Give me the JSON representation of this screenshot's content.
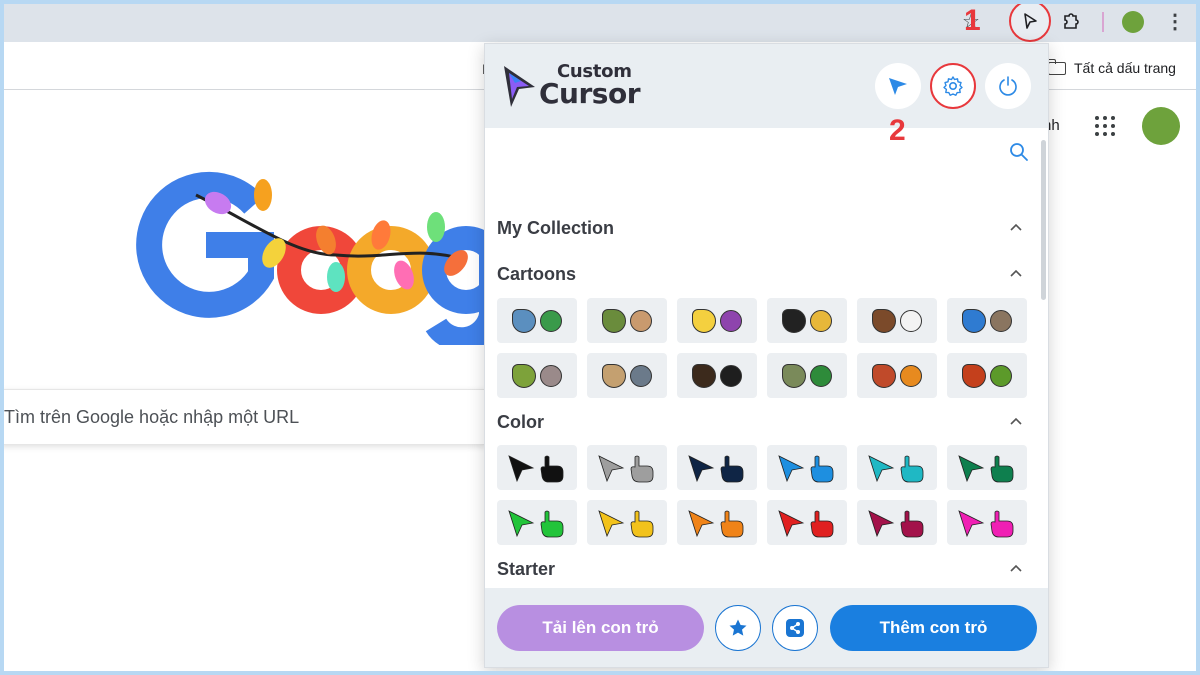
{
  "browser": {
    "bookmark_all_label": "Tất cả dấu trang",
    "bookmark_partial": "I",
    "step_labels": [
      "1",
      "2"
    ]
  },
  "google": {
    "header_partial_text": "nh",
    "search_placeholder": "Tìm trên Google hoặc nhập một URL",
    "logo_partial": "Goog"
  },
  "extension": {
    "logo": {
      "line1": "Custom",
      "line2": "Cursor"
    },
    "header_buttons": [
      "cursor-icon",
      "gear-icon",
      "power-icon"
    ],
    "sections": [
      {
        "title": "My Collection"
      },
      {
        "title": "Cartoons"
      },
      {
        "title": "Color"
      },
      {
        "title": "Starter"
      }
    ],
    "color_pairs": [
      "#111111",
      "#9e9e9e",
      "#0f2545",
      "#1e8fe0",
      "#1fb8c4",
      "#0e7f4e",
      "#22c43a",
      "#f2c21b",
      "#f08318",
      "#e02020",
      "#a3124a",
      "#f01fb4"
    ],
    "cartoon_colors": [
      [
        "#5b8fbf",
        "#3a9a4a"
      ],
      [
        "#6a8c3c",
        "#c99a6e"
      ],
      [
        "#f4d03f",
        "#8e44ad"
      ],
      [
        "#222222",
        "#e7b73a"
      ],
      [
        "#7b4a2a",
        "#f3f3f3"
      ],
      [
        "#2f7bd1",
        "#8a7560"
      ],
      [
        "#7da23a",
        "#9a8a8a"
      ],
      [
        "#c4a070",
        "#6b7a8a"
      ],
      [
        "#3c2a1c",
        "#1e1e1e"
      ],
      [
        "#7a8a5a",
        "#2e8b3a"
      ],
      [
        "#c04a2a",
        "#e78a1f"
      ],
      [
        "#c4401c",
        "#5c9a2a"
      ]
    ],
    "footer": {
      "upload_label": "Tải lên con trỏ",
      "add_label": "Thêm con trỏ",
      "favorite_icon": "star-icon",
      "share_icon": "share-icon"
    }
  }
}
